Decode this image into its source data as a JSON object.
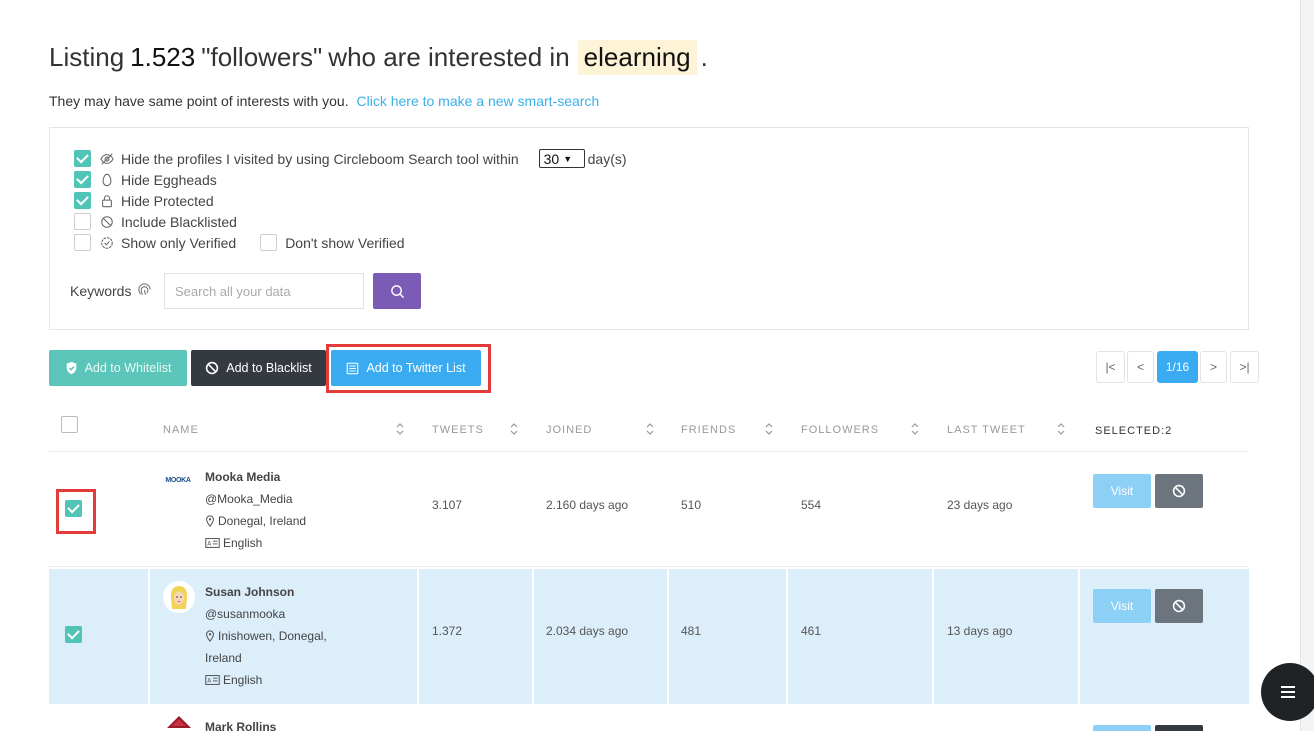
{
  "heading": {
    "prefix": "Listing",
    "count": "1.523",
    "type": "\"followers\"",
    "middle": "who are interested in",
    "keyword": "elearning",
    "suffix": "."
  },
  "subline": {
    "text": "They may have same point of interests with you.",
    "link": "Click here to make a new smart-search"
  },
  "filters": {
    "hide_visited": {
      "label": "Hide the profiles I visited by using Circleboom Search tool within",
      "checked": true
    },
    "days_value": "30",
    "days_label": "day(s)",
    "hide_eggheads": {
      "label": "Hide Eggheads",
      "checked": true
    },
    "hide_protected": {
      "label": "Hide Protected",
      "checked": true
    },
    "include_blacklisted": {
      "label": "Include Blacklisted",
      "checked": false
    },
    "show_only_verified": {
      "label": "Show only Verified",
      "checked": false
    },
    "dont_show_verified": {
      "label": "Don't show Verified",
      "checked": false
    }
  },
  "keywords": {
    "label": "Keywords",
    "placeholder": "Search all your data"
  },
  "actions": {
    "whitelist": "Add to Whitelist",
    "blacklist": "Add to Blacklist",
    "twitter_list": "Add to Twitter List"
  },
  "pagination": {
    "first": "|<",
    "prev": "<",
    "current": "1/16",
    "next": ">",
    "last": ">|"
  },
  "table": {
    "headers": {
      "name": "NAME",
      "tweets": "TWEETS",
      "joined": "JOINED",
      "friends": "FRIENDS",
      "followers": "FOLLOWERS",
      "last_tweet": "LAST TWEET",
      "selected": "SELECTED:2"
    },
    "visit_label": "Visit",
    "rows": [
      {
        "name": "Mooka Media",
        "handle": "@Mooka_Media",
        "location": "Donegal, Ireland",
        "language": "English",
        "tweets": "3.107",
        "joined": "2.160 days ago",
        "friends": "510",
        "followers": "554",
        "last_tweet": "23 days ago",
        "avatar_text": "MOOKA",
        "selected": true
      },
      {
        "name": "Susan Johnson",
        "handle": "@susanmooka",
        "location_line1": "Inishowen, Donegal,",
        "location_line2": "Ireland",
        "language": "English",
        "tweets": "1.372",
        "joined": "2.034 days ago",
        "friends": "481",
        "followers": "461",
        "last_tweet": "13 days ago",
        "selected": true
      },
      {
        "name": "Mark Rollins"
      }
    ]
  },
  "colors": {
    "teal": "#4fc4b7",
    "dark": "#343a40",
    "blue": "#3aabf0",
    "purple": "#7a5bb5",
    "highlight": "#e33a3a",
    "selected_row": "#dbeefa"
  }
}
